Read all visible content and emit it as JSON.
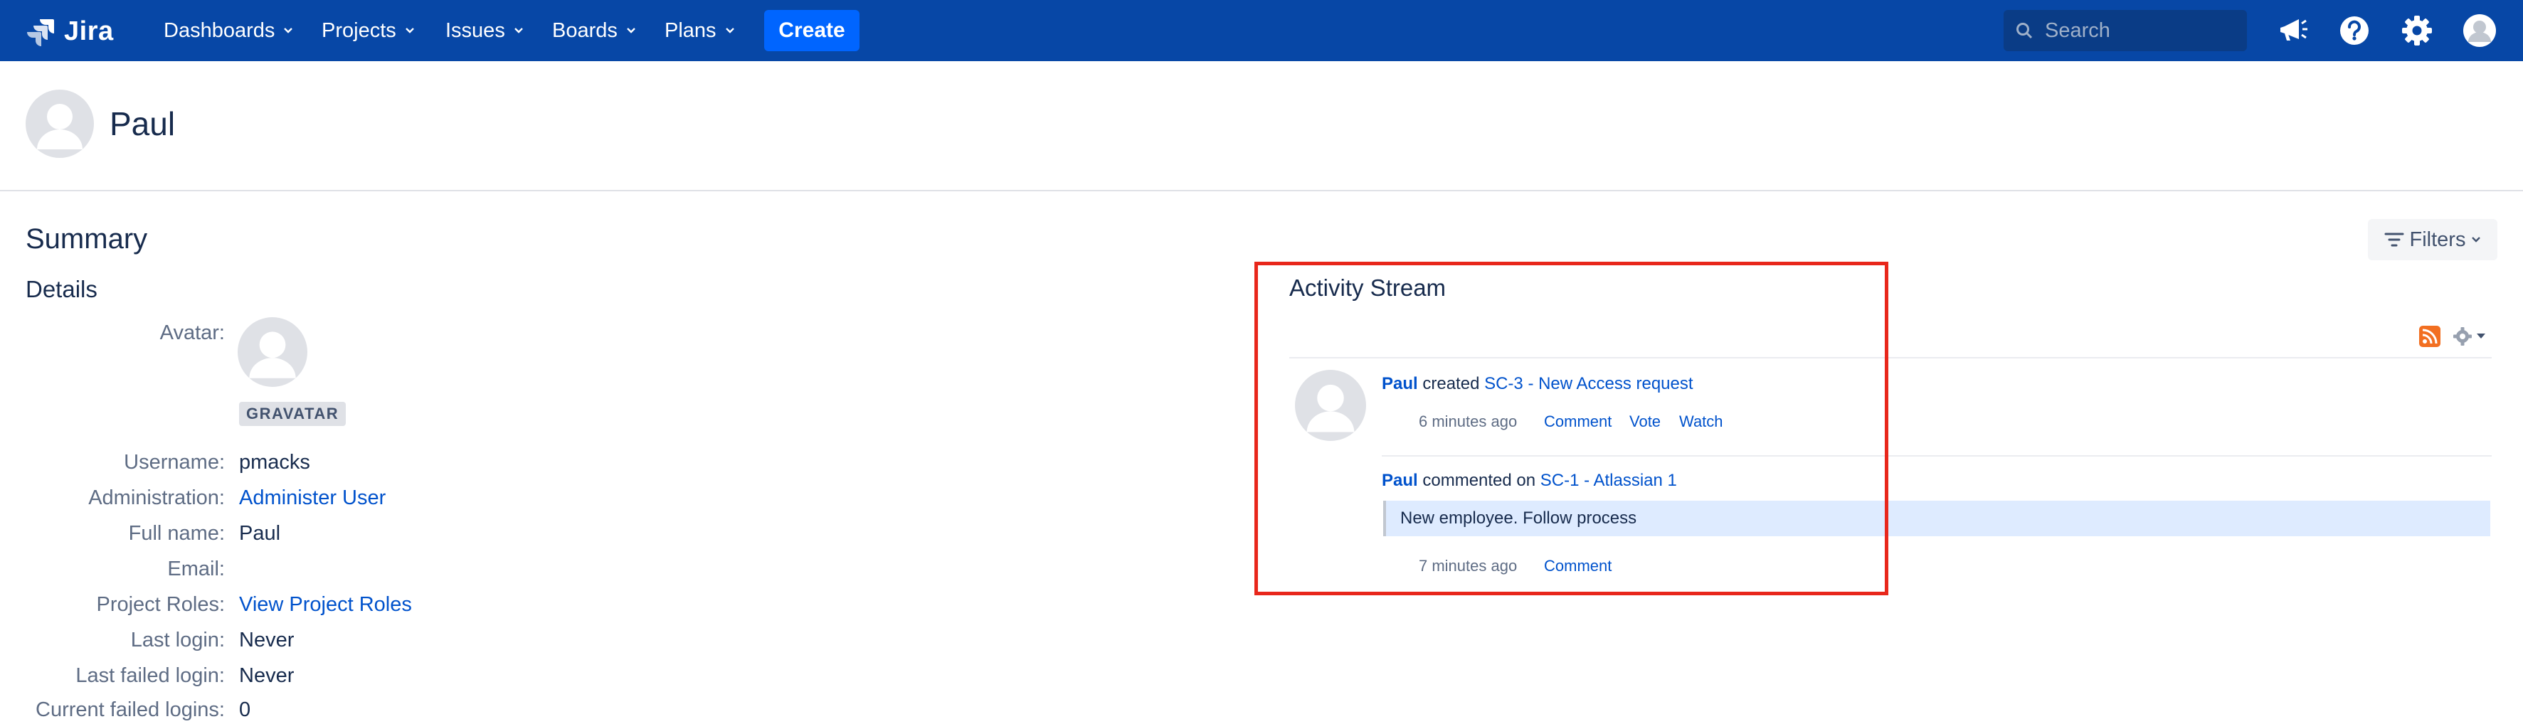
{
  "nav": {
    "logo_text": "Jira",
    "items": [
      {
        "label": "Dashboards"
      },
      {
        "label": "Projects"
      },
      {
        "label": "Issues"
      },
      {
        "label": "Boards"
      },
      {
        "label": "Plans"
      }
    ],
    "create_label": "Create",
    "search_placeholder": "Search",
    "icons": [
      "megaphone-icon",
      "help-icon",
      "settings-icon",
      "user-avatar-icon"
    ]
  },
  "profile": {
    "name": "Paul"
  },
  "summary": {
    "title": "Summary",
    "details_title": "Details",
    "avatar_label": "Avatar:",
    "gravatar_badge": "GRAVATAR",
    "rows": [
      {
        "key": "Username:",
        "value": "pmacks"
      },
      {
        "key": "Administration:",
        "value": "Administer User"
      },
      {
        "key": "Full name:",
        "value": "Paul"
      },
      {
        "key": "Email:",
        "value": ""
      },
      {
        "key": "Project Roles:",
        "value": "View Project Roles"
      },
      {
        "key": "Last login:",
        "value": "Never"
      },
      {
        "key": "Last failed login:",
        "value": "Never"
      },
      {
        "key": "Current failed logins:",
        "value": "0"
      }
    ]
  },
  "filters_label": "Filters",
  "activity": {
    "title": "Activity Stream",
    "entries": [
      {
        "user": "Paul",
        "action": "created",
        "issue": "SC-3 - New Access request",
        "time": "6 minutes ago",
        "actions": [
          "Comment",
          "Vote",
          "Watch"
        ]
      },
      {
        "user": "Paul",
        "action": "commented on",
        "issue": "SC-1 - Atlassian 1",
        "comment": "New employee. Follow process",
        "time": "7 minutes ago",
        "actions": [
          "Comment"
        ]
      }
    ]
  },
  "colors": {
    "nav_bg": "#0747a6",
    "create_bg": "#0065ff",
    "link": "#0052cc",
    "highlight": "#e8271b"
  }
}
